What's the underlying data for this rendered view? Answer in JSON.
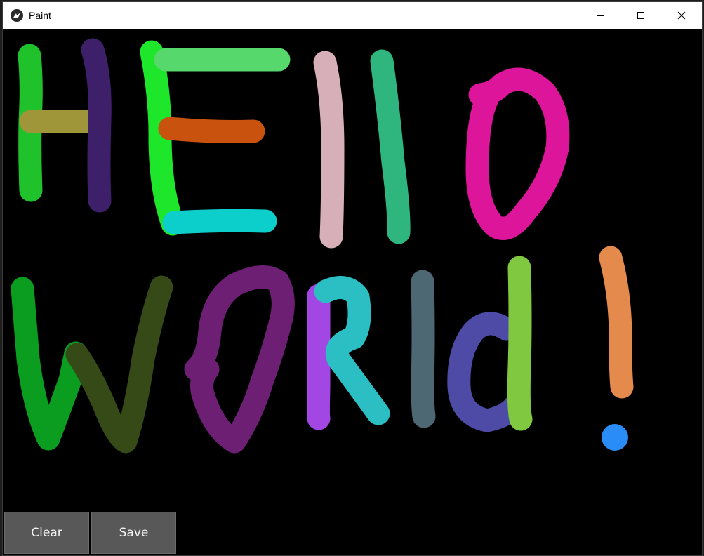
{
  "window": {
    "title": "Paint",
    "app_icon": "kivy-icon",
    "controls": [
      "minimize-icon",
      "maximize-icon",
      "close-icon"
    ]
  },
  "toolbar": {
    "clear_label": "Clear",
    "save_label": "Save"
  },
  "canvas": {
    "background": "#000000",
    "strokes": [
      {
        "name": "h-left-stroke",
        "color": "#1fc22b"
      },
      {
        "name": "h-bar-stroke",
        "color": "#9e9639"
      },
      {
        "name": "h-right-stroke",
        "color": "#3d2069"
      },
      {
        "name": "e-vertical-stroke",
        "color": "#1ee62a"
      },
      {
        "name": "e-top-stroke",
        "color": "#56d86c"
      },
      {
        "name": "e-middle-stroke",
        "color": "#c9520e"
      },
      {
        "name": "e-bottom-stroke",
        "color": "#0ccecb"
      },
      {
        "name": "l-first-stroke",
        "color": "#d6afb8"
      },
      {
        "name": "l-second-stroke",
        "color": "#2fb67e"
      },
      {
        "name": "o-loop-stroke",
        "color": "#dc159a"
      },
      {
        "name": "w-first-half-stroke",
        "color": "#0a9d1f"
      },
      {
        "name": "w-second-half-stroke",
        "color": "#364a18"
      },
      {
        "name": "second-o-loop-stroke",
        "color": "#6c1f73"
      },
      {
        "name": "r-vertical-stroke",
        "color": "#a247e4"
      },
      {
        "name": "r-curve-stroke",
        "color": "#2bbfc3"
      },
      {
        "name": "second-l-stroke",
        "color": "#4d6873"
      },
      {
        "name": "d-curve-stroke",
        "color": "#4d4ba6"
      },
      {
        "name": "d-stem-stroke",
        "color": "#7fc83f"
      },
      {
        "name": "exclamation-line-stroke",
        "color": "#e58a4d"
      },
      {
        "name": "exclamation-dot",
        "color": "#2a8cf7"
      }
    ]
  }
}
